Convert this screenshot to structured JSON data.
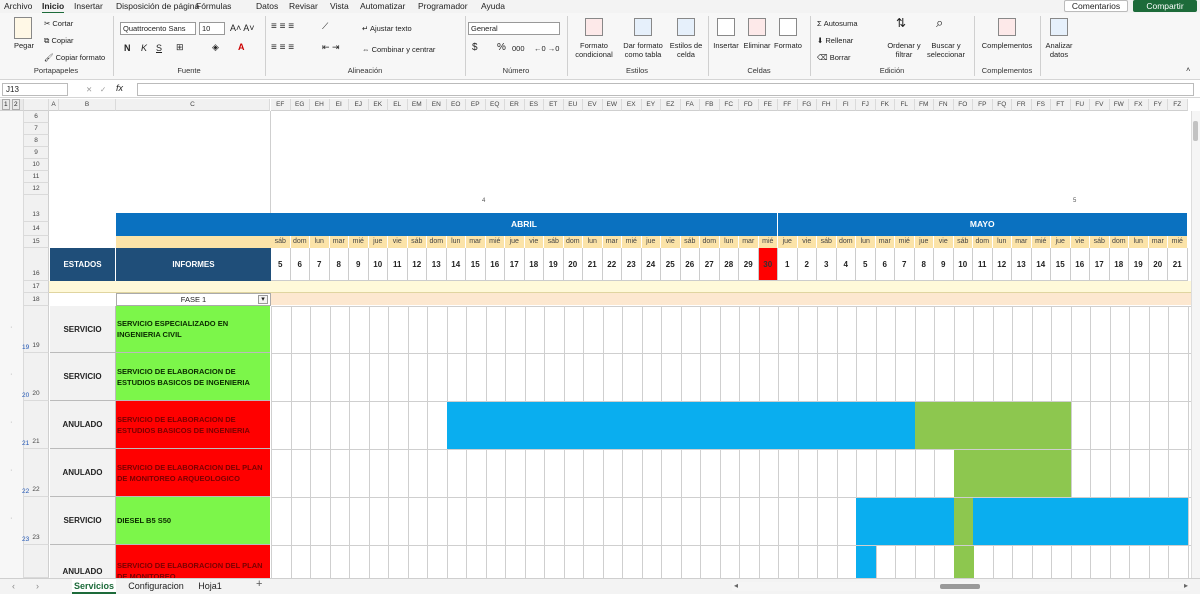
{
  "menu": [
    "Archivo",
    "Inicio",
    "Insertar",
    "Disposición de página",
    "Fórmulas",
    "Datos",
    "Revisar",
    "Vista",
    "Automatizar",
    "Programador",
    "Ayuda"
  ],
  "menu_active": "Inicio",
  "comments": "Comentarios",
  "share": "Compartir",
  "ribbon": {
    "paste": "Pegar",
    "cut": "Cortar",
    "copy": "Copiar",
    "copy_format": "Copiar formato",
    "font_name": "Quattrocento Sans",
    "font_size": "10",
    "bold": "N",
    "italic": "K",
    "underline": "S",
    "wrap_text": "Ajustar texto",
    "merge_center": "Combinar y centrar",
    "number_format": "General",
    "currency": "$",
    "percent": "%",
    "thousands": "000",
    "cond_format": "Formato condicional",
    "table_format": "Dar formato como tabla",
    "cell_styles": "Estilos de celda",
    "insert": "Insertar",
    "delete": "Eliminar",
    "format": "Formato",
    "autosum": "Autosuma",
    "fill": "Rellenar",
    "clear": "Borrar",
    "sort_filter": "Ordenar y filtrar",
    "find_select": "Buscar y seleccionar",
    "addins": "Complementos",
    "analyze": "Analizar datos",
    "groups": [
      "Portapapeles",
      "Fuente",
      "Alineación",
      "Número",
      "Estilos",
      "Celdas",
      "Edición",
      "Complementos"
    ]
  },
  "formula_bar": {
    "name_box": "J13",
    "fx": "fx",
    "value": ""
  },
  "grid": {
    "col_headers_left": [
      "A",
      "B",
      "C"
    ],
    "col_headers": [
      "EF",
      "EG",
      "EH",
      "EI",
      "EJ",
      "EK",
      "EL",
      "EM",
      "EN",
      "EO",
      "EP",
      "EQ",
      "ER",
      "ES",
      "ET",
      "EU",
      "EV",
      "EW",
      "EX",
      "EY",
      "EZ",
      "FA",
      "FB",
      "FC",
      "FD",
      "FE",
      "FF",
      "FG",
      "FH",
      "FI",
      "FJ",
      "FK",
      "FL",
      "FM",
      "FN",
      "FO",
      "FP",
      "FQ",
      "FR",
      "FS",
      "FT",
      "FU",
      "FV",
      "FW",
      "FX",
      "FY",
      "FZ"
    ],
    "row_numbers": [
      "6",
      "7",
      "8",
      "9",
      "10",
      "11",
      "12",
      "13",
      "14",
      "15",
      "16",
      "17",
      "18",
      "19",
      "20",
      "21",
      "22",
      "23"
    ],
    "week_markers": [
      "4",
      "5"
    ],
    "months": [
      {
        "label": "ABRIL",
        "from": 0,
        "to": 26
      },
      {
        "label": "MAYO",
        "from": 26,
        "to": 47
      }
    ],
    "days_of_week": [
      "sáb",
      "dom",
      "lun",
      "mar",
      "mié",
      "jue",
      "vie",
      "sáb",
      "dom",
      "lun",
      "mar",
      "mié",
      "jue",
      "vie",
      "sáb",
      "dom",
      "lun",
      "mar",
      "mié",
      "jue",
      "vie",
      "sáb",
      "dom",
      "lun",
      "mar",
      "mié",
      "jue",
      "vie",
      "sáb",
      "dom",
      "lun",
      "mar",
      "mié",
      "jue",
      "vie",
      "sáb",
      "dom",
      "lun",
      "mar",
      "mié",
      "jue",
      "vie",
      "sáb",
      "dom",
      "lun",
      "mar",
      "mié"
    ],
    "day_numbers": [
      "5",
      "6",
      "7",
      "8",
      "9",
      "10",
      "11",
      "12",
      "13",
      "14",
      "15",
      "16",
      "17",
      "18",
      "19",
      "20",
      "21",
      "22",
      "23",
      "24",
      "25",
      "26",
      "27",
      "28",
      "29",
      "30",
      "1",
      "2",
      "3",
      "4",
      "5",
      "6",
      "7",
      "8",
      "9",
      "10",
      "11",
      "12",
      "13",
      "14",
      "15",
      "16",
      "17",
      "18",
      "19",
      "20",
      "21"
    ],
    "highlight_day_index": 25,
    "header_estados": "ESTADOS",
    "header_informes": "INFORMES",
    "phase": "FASE 1",
    "colors": {
      "servicio": "#7cf64a",
      "anulado": "#ff0000",
      "blue": "#0aaeef",
      "green": "#8dc74f",
      "header": "#1f4e79",
      "month": "#0a71c0"
    }
  },
  "rows": [
    {
      "row": "19",
      "estado": "SERVICIO",
      "informe": "SERVICIO ESPECIALIZADO EN INGENIERIA CIVIL",
      "type": "servicio",
      "bars": []
    },
    {
      "row": "20",
      "estado": "SERVICIO",
      "informe": "SERVICIO DE ELABORACION DE ESTUDIOS BASICOS DE INGENIERIA",
      "type": "servicio",
      "bars": []
    },
    {
      "row": "21",
      "estado": "ANULADO",
      "informe": "SERVICIO DE ELABORACION DE ESTUDIOS BASICOS DE INGENIERIA",
      "type": "anulado",
      "bars": [
        {
          "from": 9,
          "to": 33,
          "color": "blue"
        },
        {
          "from": 33,
          "to": 41,
          "color": "green"
        }
      ]
    },
    {
      "row": "22",
      "estado": "ANULADO",
      "informe": "SERVICIO DE ELABORACION DEL PLAN DE MONITOREO ARQUEOLOGICO",
      "type": "anulado",
      "bars": [
        {
          "from": 35,
          "to": 41,
          "color": "green"
        }
      ]
    },
    {
      "row": "23",
      "estado": "SERVICIO",
      "informe": "DIESEL B5 S50",
      "type": "servicio",
      "bars": [
        {
          "from": 30,
          "to": 35,
          "color": "blue"
        },
        {
          "from": 35,
          "to": 36,
          "color": "green"
        },
        {
          "from": 36,
          "to": 47,
          "color": "blue"
        }
      ]
    },
    {
      "row": "",
      "estado": "ANULADO",
      "informe": "SERVICIO DE ELABORACION DEL PLAN DE MONITOREO",
      "type": "anulado",
      "bars": [
        {
          "from": 30,
          "to": 31,
          "color": "blue"
        },
        {
          "from": 35,
          "to": 36,
          "color": "green"
        }
      ]
    }
  ],
  "tabs": [
    "Servicios",
    "Configuracion",
    "Hoja1"
  ],
  "active_tab": "Servicios",
  "add_sheet": "+"
}
